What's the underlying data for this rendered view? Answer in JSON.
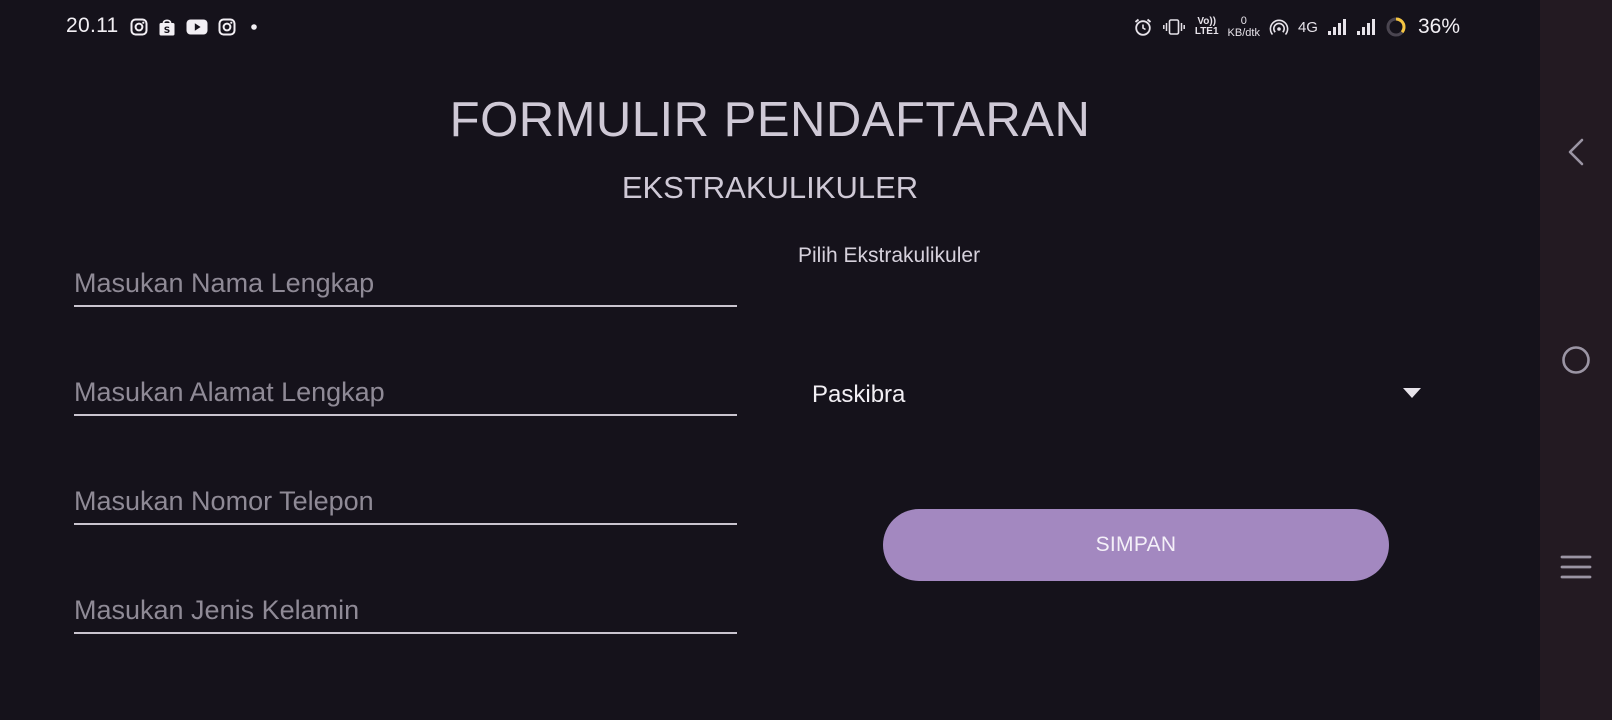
{
  "status_bar": {
    "time": "20.11",
    "notification_icons": [
      "instagram-icon",
      "shopee-bag-icon",
      "youtube-icon",
      "instagram-icon",
      "dot-icon"
    ],
    "volte_label_top": "Vo))",
    "volte_label_bottom": "LTE1",
    "speed_value": "0",
    "speed_unit": "KB/dtk",
    "network_type": "4G",
    "battery_percent": "36%",
    "battery_ring_color": "#f5c542"
  },
  "form": {
    "title": "FORMULIR PENDAFTARAN",
    "subtitle": "EKSTRAKULIKULER",
    "fields": [
      {
        "placeholder": "Masukan Nama Lengkap",
        "value": ""
      },
      {
        "placeholder": "Masukan Alamat Lengkap",
        "value": ""
      },
      {
        "placeholder": "Masukan Nomor Telepon",
        "value": ""
      },
      {
        "placeholder": "Masukan Jenis Kelamin",
        "value": ""
      }
    ],
    "select_label": "Pilih Ekstrakulikuler",
    "selected_option": "Paskibra",
    "save_label": "SIMPAN"
  },
  "colors": {
    "background": "#15121b",
    "accent_button": "#a388c0",
    "nav_bar": "#231a22"
  },
  "nav_bar": {
    "icons": [
      "back-icon",
      "home-icon",
      "recents-icon"
    ]
  }
}
